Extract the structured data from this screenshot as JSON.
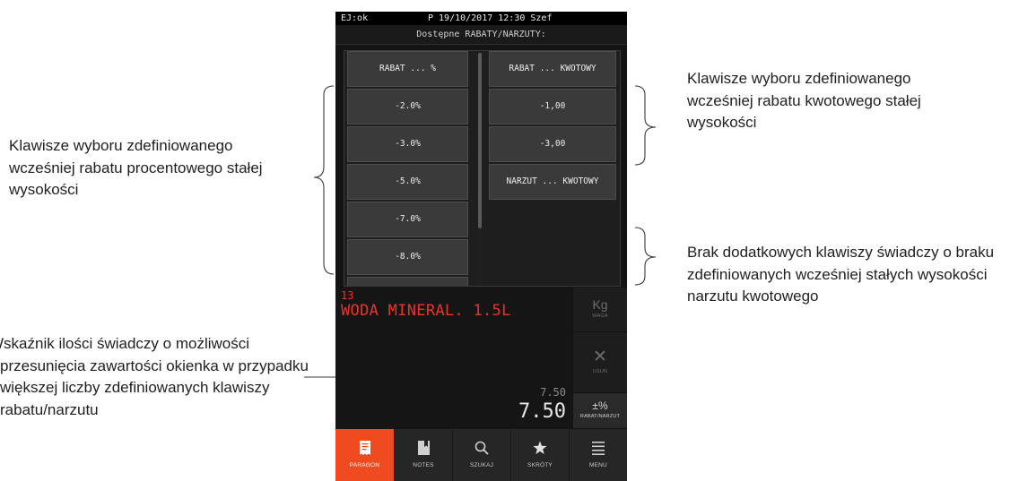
{
  "annotations": {
    "left_1": "Klawisze wyboru zdefiniowanego wcześniej rabatu procentowego stałej wysokości",
    "left_2": "Wskaźnik ilości świadczy o możliwości przesunięcia zawartości okienka w przypadku większej liczby zdefiniowanych klawiszy rabatu/narzutu",
    "right_1": "Klawisze wyboru zdefiniowanego wcześniej rabatu kwotowego stałej wysokości",
    "right_2": "Brak dodatkowych klawiszy świadczy o braku zdefiniowanych wcześniej stałych wysokości narzutu kwotowego"
  },
  "status_bar": {
    "left": "EJ:ok",
    "center": "P 19/10/2017 12:30 Szef"
  },
  "title": "Dostępne RABATY/NARZUTY:",
  "keys_left": [
    "RABAT ... %",
    "-2.0%",
    "-3.0%",
    "-5.0%",
    "-7.0%",
    "-8.0%"
  ],
  "keys_right": [
    "RABAT ... KWOTOWY",
    "-1,00",
    "-3,00",
    "NARZUT ... KWOTOWY"
  ],
  "receipt": {
    "code": "13",
    "item_name": "WODA MINERAL. 1.5L",
    "unit_price": "7.50",
    "total": "7.50"
  },
  "side_buttons": {
    "kg": {
      "icon_text": "Kg",
      "label": "WAGA"
    },
    "usun": {
      "icon_text": "✕",
      "label": "USUŃ"
    },
    "rabat": {
      "icon_text": "±%",
      "label": "RABAT/NARZUT"
    }
  },
  "tabs": [
    {
      "label": "PARAGON",
      "icon": "receipt-icon",
      "active": true
    },
    {
      "label": "NOTES",
      "icon": "bookmark-icon"
    },
    {
      "label": "SZUKAJ",
      "icon": "search-icon"
    },
    {
      "label": "SKRÓTY",
      "icon": "star-icon"
    },
    {
      "label": "MENU",
      "icon": "menu-icon"
    }
  ],
  "colors": {
    "accent": "#f04a21",
    "receipt_text": "#e7352b",
    "screen_bg": "#131313",
    "key_bg": "#3a3a3a"
  }
}
